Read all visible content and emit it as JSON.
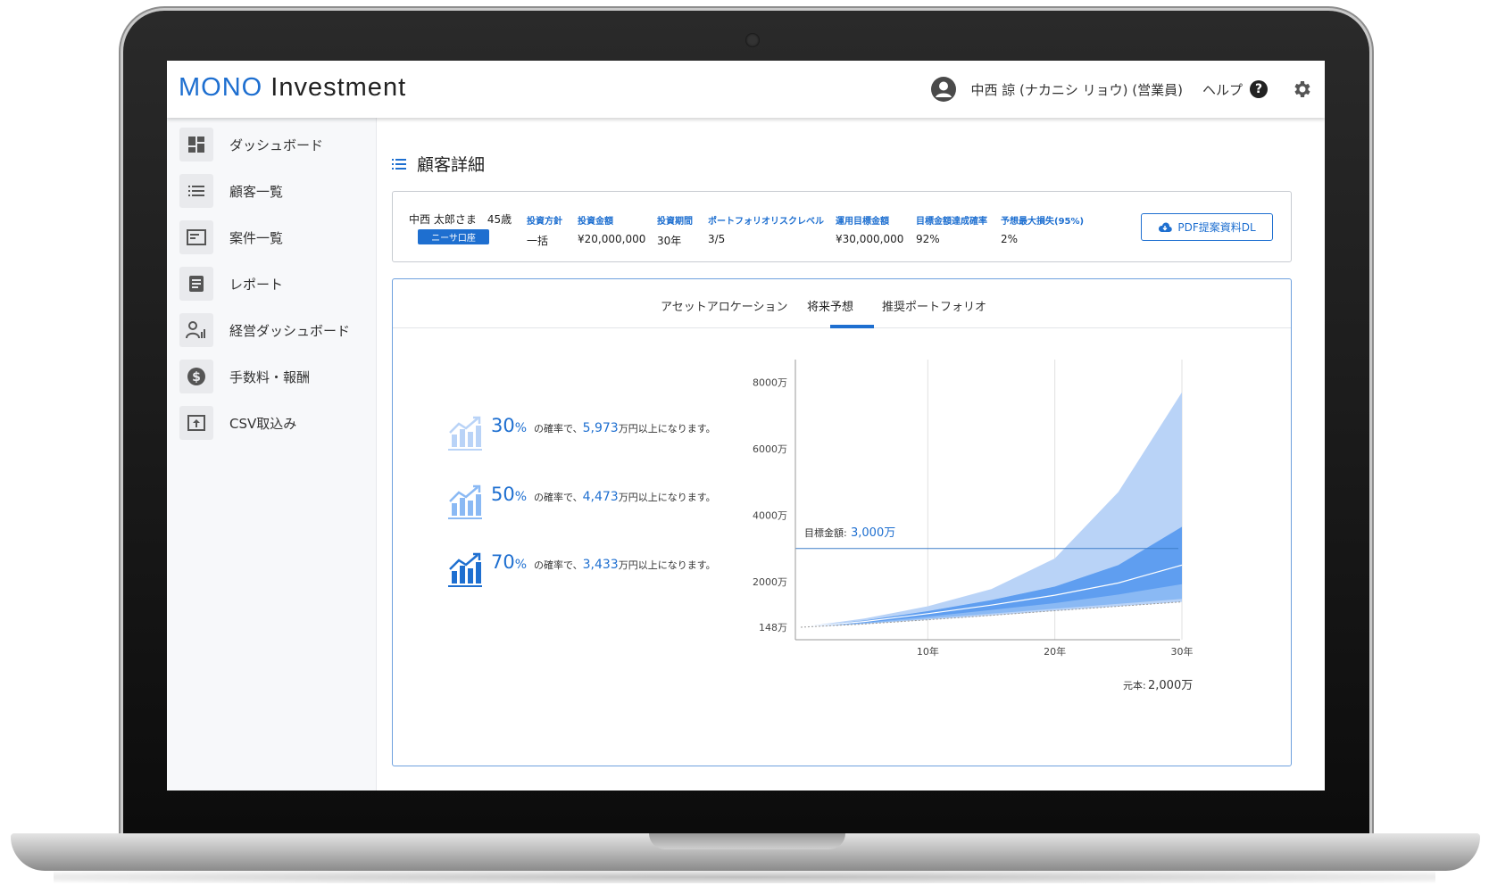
{
  "header": {
    "logo_brand": "MONO",
    "logo_product": "Investment",
    "user_name": "中西 諒 (ナカニシ リョウ) (営業員)",
    "help_label": "ヘルプ"
  },
  "sidebar": {
    "items": [
      {
        "label": "ダッシュボード",
        "icon": "dashboard-icon"
      },
      {
        "label": "顧客一覧",
        "icon": "list-icon"
      },
      {
        "label": "案件一覧",
        "icon": "folder-icon"
      },
      {
        "label": "レポート",
        "icon": "report-icon"
      },
      {
        "label": "経営ダッシュボード",
        "icon": "management-icon"
      },
      {
        "label": "手数料・報酬",
        "icon": "dollar-icon"
      },
      {
        "label": "CSV取込み",
        "icon": "upload-icon"
      }
    ]
  },
  "page": {
    "title": "顧客詳細"
  },
  "summary": {
    "customer": "中西 太郎さま　45歳",
    "badge": "ニーサ口座",
    "stats": [
      {
        "label": "投資方針",
        "value": "一括"
      },
      {
        "label": "投資金額",
        "value": "¥20,000,000"
      },
      {
        "label": "投資期間",
        "value": "30年"
      },
      {
        "label": "ポートフォリオリスクレベル",
        "value": "3/5"
      },
      {
        "label": "運用目標金額",
        "value": "¥30,000,000"
      },
      {
        "label": "目標金額達成確率",
        "value": "92%"
      },
      {
        "label": "予想最大損失(95%)",
        "value": "2%"
      }
    ],
    "pdf_button": "PDF提案資料DL"
  },
  "tabs": [
    {
      "label": "アセットアロケーション",
      "active": false
    },
    {
      "label": "将来予想",
      "active": true
    },
    {
      "label": "推奨ポートフォリオ",
      "active": false
    }
  ],
  "probabilities": [
    {
      "pct": "30",
      "sign": "%",
      "pre": "の確率で、",
      "amount": "5,973",
      "post": "万円以上になります。",
      "shade": "light"
    },
    {
      "pct": "50",
      "sign": "%",
      "pre": "の確率で、",
      "amount": "4,473",
      "post": "万円以上になります。",
      "shade": "medium"
    },
    {
      "pct": "70",
      "sign": "%",
      "pre": "の確率で、",
      "amount": "3,433",
      "post": "万円以上になります。",
      "shade": "dark"
    }
  ],
  "colors": {
    "accent": "#1e6fd0",
    "band_outer": "#b9d3f7",
    "band_inner": "#5f9ef0",
    "band_mid": "#8ab9f4"
  },
  "chart_data": {
    "type": "area",
    "x": [
      0,
      5,
      10,
      15,
      20,
      25,
      30
    ],
    "x_ticks": [
      {
        "value": 10,
        "label": "10年"
      },
      {
        "value": 20,
        "label": "20年"
      },
      {
        "value": 30,
        "label": "30年"
      }
    ],
    "y_ticks": [
      {
        "value": 148,
        "label": "148万"
      },
      {
        "value": 2000,
        "label": "2000万"
      },
      {
        "value": 4000,
        "label": "4000万"
      },
      {
        "value": 6000,
        "label": "6000万"
      },
      {
        "value": 8000,
        "label": "8000万"
      }
    ],
    "xlim": [
      0,
      30
    ],
    "series": [
      {
        "values": [
          148,
          500,
          1000,
          1700,
          2700,
          4700,
          7700
        ]
      },
      {
        "values": [
          148,
          420,
          800,
          1250,
          1800,
          2500,
          3650
        ]
      },
      {
        "values": [
          148,
          380,
          700,
          1050,
          1450,
          1950,
          2500
        ]
      },
      {
        "values": [
          148,
          330,
          580,
          850,
          1130,
          1480,
          1900
        ]
      },
      {
        "values": [
          148,
          300,
          500,
          700,
          900,
          1100,
          1300
        ]
      },
      {
        "values": [
          148,
          280,
          450,
          630,
          820,
          1000,
          1180
        ]
      }
    ],
    "target_label": "目標金額:",
    "target_value_label": "3,000万",
    "target_value": 3000,
    "principal_label": "元本:",
    "principal_value_label": "2,000万"
  }
}
